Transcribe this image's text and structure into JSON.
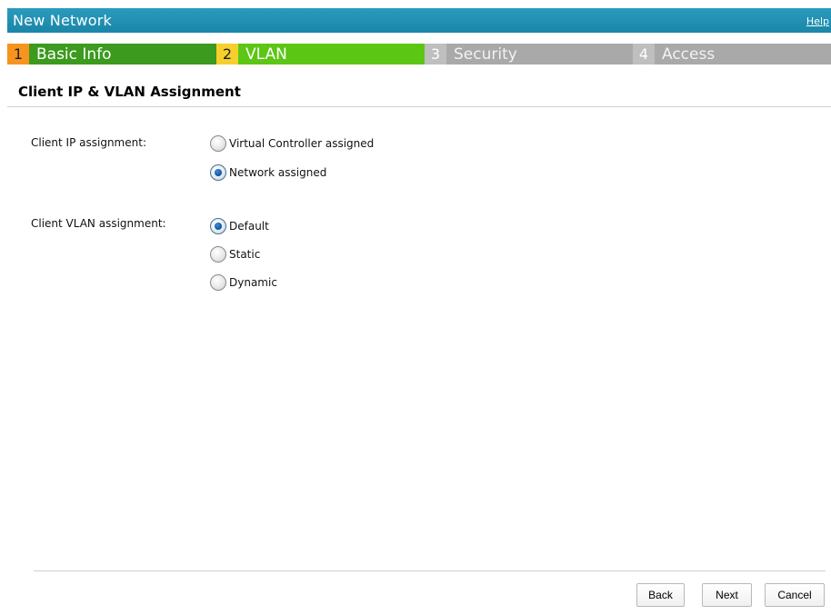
{
  "window": {
    "title": "New Network",
    "help_label": "Help"
  },
  "steps": [
    {
      "number": "1",
      "label": "Basic Info",
      "state": "completed"
    },
    {
      "number": "2",
      "label": "VLAN",
      "state": "active"
    },
    {
      "number": "3",
      "label": "Security",
      "state": "disabled"
    },
    {
      "number": "4",
      "label": "Access",
      "state": "disabled"
    }
  ],
  "section": {
    "title": "Client IP & VLAN Assignment"
  },
  "client_ip": {
    "label": "Client IP assignment:",
    "options": [
      {
        "label": "Virtual Controller assigned",
        "checked": false
      },
      {
        "label": "Network assigned",
        "checked": true
      }
    ]
  },
  "client_vlan": {
    "label": "Client VLAN assignment:",
    "options": [
      {
        "label": "Default",
        "checked": true
      },
      {
        "label": "Static",
        "checked": false
      },
      {
        "label": "Dynamic",
        "checked": false
      }
    ]
  },
  "footer": {
    "back_label": "Back",
    "next_label": "Next",
    "cancel_label": "Cancel"
  },
  "colors": {
    "titlebar": "#1a86a8",
    "step_done": "#3c9a1e",
    "step_active": "#5cc614",
    "step_disabled": "#a9a9a9",
    "step1_num": "#f7941d",
    "step2_num": "#f5d02c"
  }
}
